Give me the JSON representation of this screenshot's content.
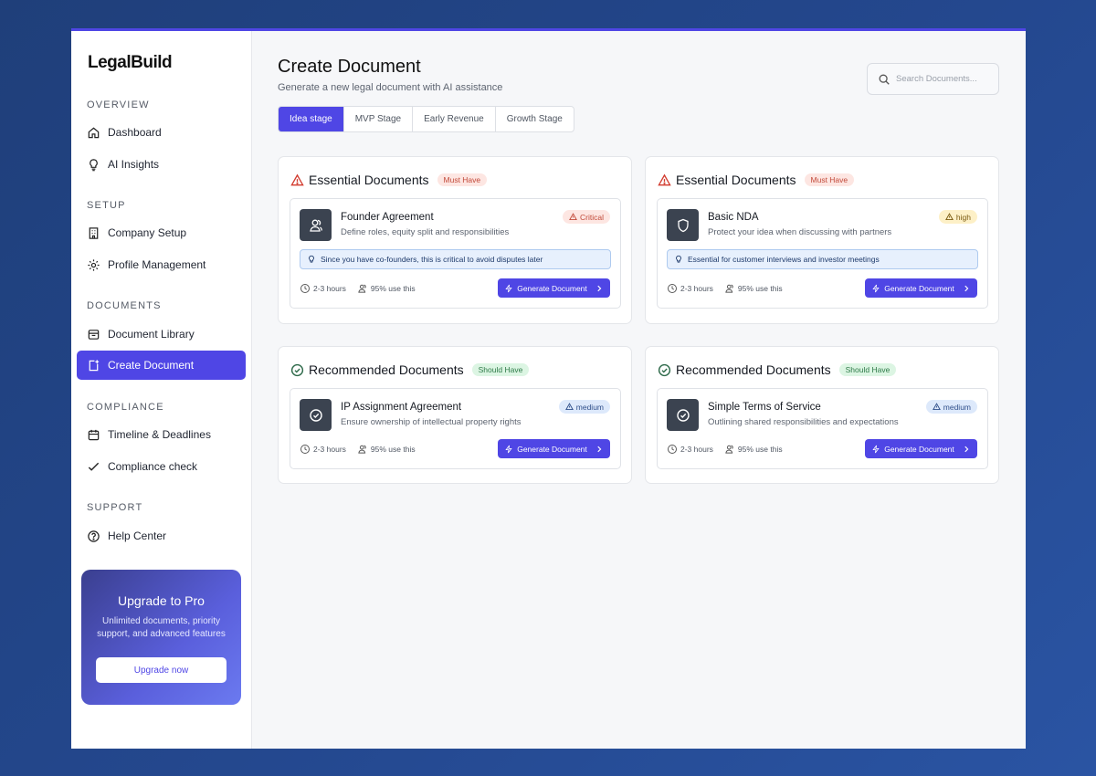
{
  "brand": {
    "logo": "LegalBuild"
  },
  "sidebar": {
    "sections": [
      {
        "title": "OVERVIEW",
        "items": [
          {
            "label": "Dashboard",
            "icon": "home-icon"
          },
          {
            "label": "AI Insights",
            "icon": "lightbulb-icon"
          }
        ]
      },
      {
        "title": "SETUP",
        "items": [
          {
            "label": "Company Setup",
            "icon": "building-icon"
          },
          {
            "label": "Profile Management",
            "icon": "gear-icon"
          }
        ]
      },
      {
        "title": "DOCUMENTS",
        "items": [
          {
            "label": "Document Library",
            "icon": "archive-icon"
          },
          {
            "label": "Create Document",
            "icon": "file-plus-icon",
            "active": true
          }
        ]
      },
      {
        "title": "COMPLIANCE",
        "items": [
          {
            "label": "Timeline & Deadlines",
            "icon": "calendar-icon"
          },
          {
            "label": "Compliance check",
            "icon": "check-icon"
          }
        ]
      },
      {
        "title": "SUPPORT",
        "items": [
          {
            "label": "Help Center",
            "icon": "help-icon"
          }
        ]
      }
    ],
    "upgrade": {
      "title": "Upgrade to Pro",
      "description": "Unlimited documents, priority support, and advanced features",
      "button": "Upgrade now"
    }
  },
  "header": {
    "title": "Create Document",
    "subtitle": "Generate a new legal document with AI assistance",
    "search_placeholder": "Search Documents..."
  },
  "tabs": [
    {
      "label": "Idea stage",
      "active": true
    },
    {
      "label": "MVP Stage"
    },
    {
      "label": "Early Revenue"
    },
    {
      "label": "Growth Stage"
    }
  ],
  "colors": {
    "accent": "#4f46e5",
    "critical": "#c24a3a",
    "success": "#2e7a48"
  },
  "cards": [
    {
      "section_title": "Essential Documents",
      "section_icon": "warning-icon",
      "badge": "Must Have",
      "badge_type": "must",
      "doc": {
        "title": "Founder Agreement",
        "description": "Define roles, equity split and responsibilities",
        "priority": "Critical",
        "priority_type": "critical",
        "icon": "users-icon",
        "tip": "Since you have co-founders, this is critical to avoid disputes later",
        "time": "2-3 hours",
        "usage": "95% use this",
        "button": "Generate Document"
      }
    },
    {
      "section_title": "Essential Documents",
      "section_icon": "warning-icon",
      "badge": "Must Have",
      "badge_type": "must",
      "doc": {
        "title": "Basic NDA",
        "description": "Protect your idea when discussing with partners",
        "priority": "high",
        "priority_type": "high",
        "icon": "shield-icon",
        "tip": "Essential for customer interviews and investor meetings",
        "time": "2-3 hours",
        "usage": "95% use this",
        "button": "Generate Document"
      }
    },
    {
      "section_title": "Recommended Documents",
      "section_icon": "check-circle-icon",
      "badge": "Should Have",
      "badge_type": "should",
      "doc": {
        "title": "IP Assignment Agreement",
        "description": "Ensure ownership of intellectual property rights",
        "priority": "medium",
        "priority_type": "medium",
        "icon": "check-circle-icon",
        "time": "2-3 hours",
        "usage": "95% use this",
        "button": "Generate Document"
      }
    },
    {
      "section_title": "Recommended Documents",
      "section_icon": "check-circle-icon",
      "badge": "Should Have",
      "badge_type": "should",
      "doc": {
        "title": "Simple Terms of Service",
        "description": "Outlining shared responsibilities and expectations",
        "priority": "medium",
        "priority_type": "medium",
        "icon": "check-circle-icon",
        "time": "2-3 hours",
        "usage": "95% use this",
        "button": "Generate Document"
      }
    }
  ]
}
